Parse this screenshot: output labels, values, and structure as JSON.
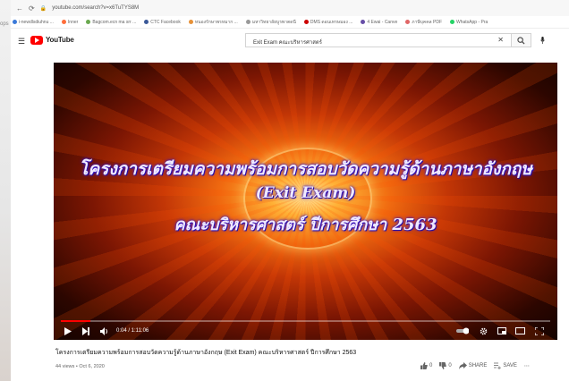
{
  "browser": {
    "url": "youtube.com/search?v=x6TuTYS8M",
    "bookmarks": [
      {
        "label": "i-newdlsdiuhnu ...",
        "color": "#3b7ad9"
      },
      {
        "label": "Inner",
        "color": "#ff6d3a"
      },
      {
        "label": "Bagcom.ecn ma srr ...",
        "color": "#6aa84f"
      },
      {
        "label": "CTC Facebook",
        "color": "#3b5998"
      },
      {
        "label": "หนองรักษาพรหมาก ...",
        "color": "#e69138"
      },
      {
        "label": "มหาวิทยาลัยบูรพาตดนี",
        "color": "#999999"
      },
      {
        "label": "DMS ดอนเทรษมอง ...",
        "color": "#cc0000"
      },
      {
        "label": "4 Ewai - Canve",
        "color": "#674ea7"
      },
      {
        "label": "ภาษีบุคคล PDF",
        "color": "#e06666"
      },
      {
        "label": "WhatsApp - Pra",
        "color": "#25d366"
      }
    ],
    "left_strip_label": "ops"
  },
  "youtube": {
    "menu_icon": "☰",
    "logo_text": "YouTube",
    "search_query": "Exit Exam คณะบริหารศาสตร์",
    "clear_icon": "✕"
  },
  "video": {
    "title_line1": "โครงการเตรียมความพร้อมการสอบวัดความรู้ด้านภาษาอังกฤษ",
    "title_line2": "(Exit Exam)",
    "title_line3": "คณะบริหารศาสตร์ ปีการศึกษา 2563",
    "time": "0:04 / 1:11:06",
    "progress": 0.06
  },
  "info": {
    "caption": "โครงการเตรียมความพร้อมการสอบวัดความรู้ด้านภาษาอังกฤษ (Exit Exam) คณะบริหารศาสตร์ ปีการศึกษา 2563",
    "meta": "44 views • Oct 6, 2020",
    "likes": "0",
    "dislikes": "0",
    "share_label": "SHARE",
    "save_label": "SAVE"
  }
}
